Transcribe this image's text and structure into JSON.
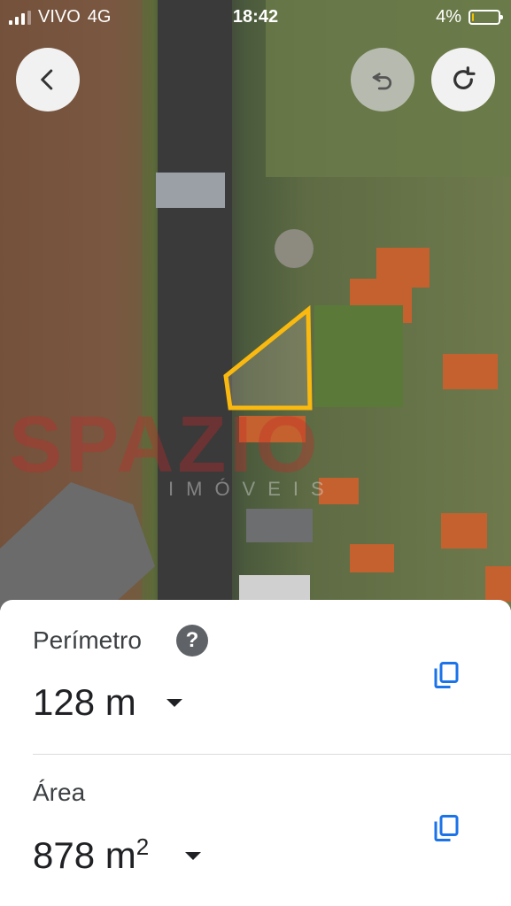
{
  "status_bar": {
    "carrier": "VIVO",
    "network": "4G",
    "time": "18:42",
    "battery": "4%",
    "battery_level": 0.04
  },
  "map": {
    "watermark": "SPAZIO",
    "watermark_sub": "IMÓVEIS",
    "polygon_color": "#f9b90f"
  },
  "measure": {
    "perimeter_label": "Perímetro",
    "perimeter_value": "128 m",
    "help": "?",
    "area_label": "Área",
    "area_value": "878 m",
    "area_unit_sup": "2"
  },
  "icons": {
    "back": "chevron-left-icon",
    "undo": "undo-icon",
    "redo": "redo-icon",
    "copy": "copy-icon",
    "help": "help-icon"
  },
  "colors": {
    "accent": "#1a73e8",
    "help_bg": "#5f6368"
  }
}
